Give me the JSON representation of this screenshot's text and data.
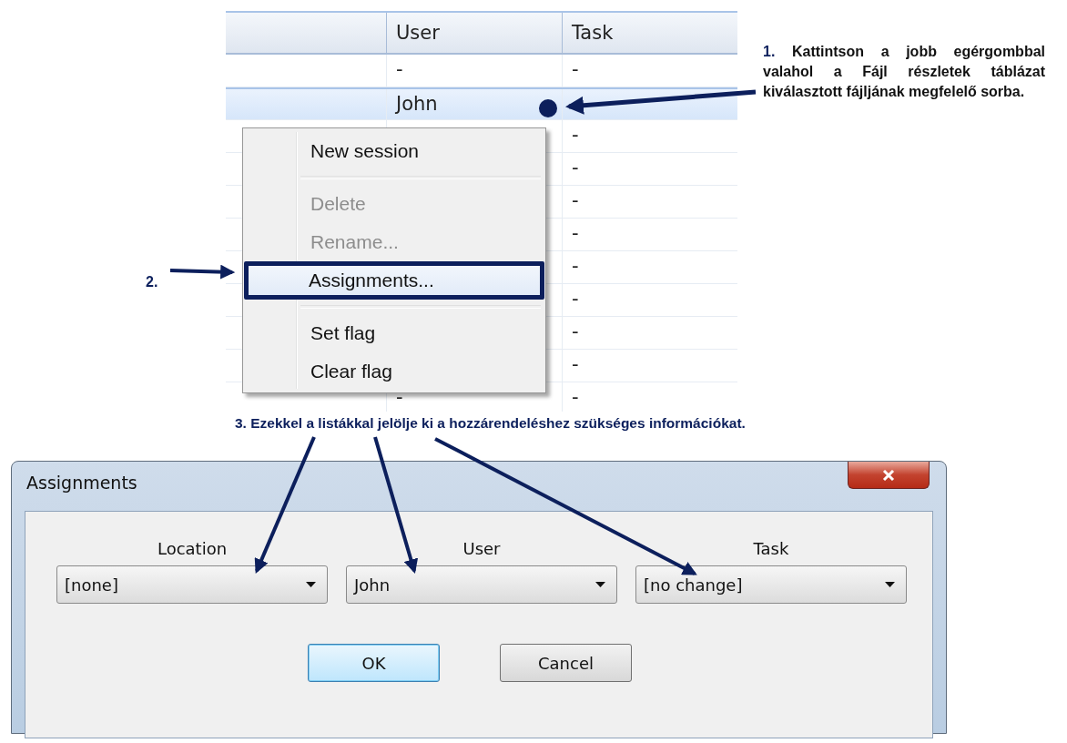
{
  "table": {
    "columns": [
      {
        "label": "User"
      },
      {
        "label": "Task"
      }
    ],
    "rows": [
      {
        "user": "-",
        "task": "-",
        "selected": false
      },
      {
        "user": "John",
        "task": "",
        "selected": true
      },
      {
        "task": "-",
        "selected": false
      },
      {
        "task": "-",
        "selected": false
      },
      {
        "task": "-",
        "selected": false
      },
      {
        "task": "-",
        "selected": false
      },
      {
        "task": "-",
        "selected": false
      },
      {
        "task": "-",
        "selected": false
      },
      {
        "task": "-",
        "selected": false
      },
      {
        "task": "-",
        "selected": false
      },
      {
        "user": "-",
        "task": "-",
        "selected": false
      }
    ]
  },
  "context_menu": {
    "items": [
      {
        "kind": "item",
        "label": "New session",
        "disabled": false,
        "selected": false
      },
      {
        "kind": "separator"
      },
      {
        "kind": "item",
        "label": "Delete",
        "disabled": true,
        "selected": false
      },
      {
        "kind": "item",
        "label": "Rename...",
        "disabled": true,
        "selected": false
      },
      {
        "kind": "item",
        "label": "Assignments...",
        "disabled": false,
        "selected": true
      },
      {
        "kind": "separator"
      },
      {
        "kind": "item",
        "label": "Set flag",
        "disabled": false,
        "selected": false
      },
      {
        "kind": "item",
        "label": "Clear flag",
        "disabled": false,
        "selected": false
      }
    ]
  },
  "annotations": [
    {
      "number": "1.",
      "text": "Kattintson a jobb egérgombbal valahol a Fájl részletek táblázat kiválasztott fájljának megfelelő sorba."
    },
    {
      "number": "2."
    },
    {
      "text": "3. Ezekkel a listákkal jelölje ki a hozzárendeléshez szükséges információkat."
    }
  ],
  "dialog": {
    "title": "Assignments",
    "fields": [
      {
        "label": "Location",
        "value": "[none]"
      },
      {
        "label": "User",
        "value": "John"
      },
      {
        "label": "Task",
        "value": "[no change]"
      }
    ],
    "buttons": [
      {
        "label": "OK",
        "default": true
      },
      {
        "label": "Cancel",
        "default": false
      }
    ]
  }
}
